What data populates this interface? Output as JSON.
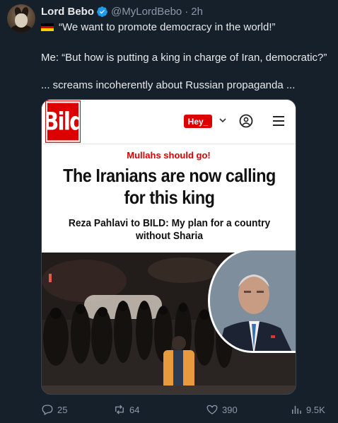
{
  "author": {
    "name": "Lord Bebo",
    "handle": "@MyLordBebo",
    "separator": "·",
    "time": "2h"
  },
  "tweet": {
    "flag": "germany-flag",
    "line1": "“We want to promote democracy in the world!”",
    "line2": "Me: “But how is putting a king in charge of Iran, democratic?”",
    "line3": "... screams incoherently about Russian propaganda ..."
  },
  "card": {
    "logo_text": "Bild",
    "hey_label": "Hey_",
    "kicker": "Mullahs should go!",
    "headline": "The Iranians are now calling for this king",
    "subhead": "Reza Pahlavi to BILD: My plan for a country without Sharia"
  },
  "actions": {
    "replies": "25",
    "reposts": "64",
    "likes": "390",
    "views": "9.5K"
  },
  "colors": {
    "background": "#15202b",
    "verified": "#1d9bf0",
    "muted": "#8b98a5",
    "bild_red": "#dd0000"
  }
}
